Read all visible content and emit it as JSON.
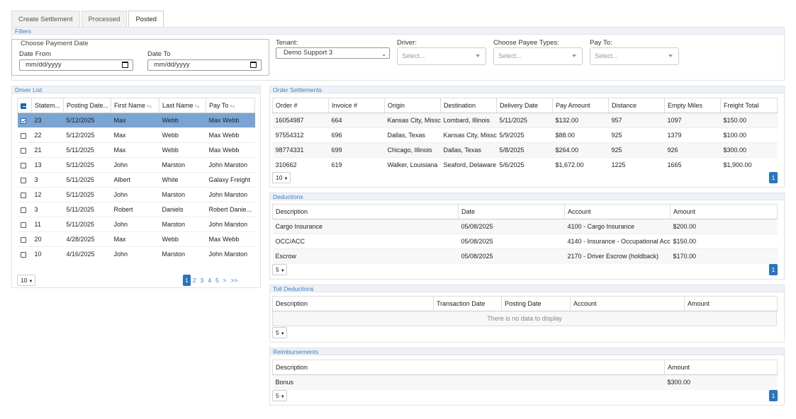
{
  "tabs": [
    "Create Settlement",
    "Processed",
    "Posted"
  ],
  "active_tab": "Posted",
  "filters": {
    "title": "Filters",
    "payment_date_group": "Choose Payment Date",
    "date_from_label": "Date From",
    "date_from_value": "mm/dd/yyyy",
    "date_to_label": "Date To",
    "date_to_value": "mm/dd/yyyy",
    "tenant_label": "Tenant:",
    "tenant_value": "Demo Support 3",
    "driver_label": "Driver:",
    "driver_placeholder": "Select...",
    "payee_types_label": "Choose Payee Types:",
    "payee_types_placeholder": "Select...",
    "pay_to_label": "Pay To:",
    "pay_to_placeholder": "Select..."
  },
  "driver_list": {
    "title": "Driver List",
    "columns": [
      "Statem...",
      "Posting Date...",
      "First Name",
      "Last Name",
      "Pay To"
    ],
    "rows": [
      {
        "checked": true,
        "statement": "23",
        "date": "5/12/2025",
        "first": "Max",
        "last": "Webb",
        "pay_to": "Max Webb"
      },
      {
        "checked": false,
        "statement": "22",
        "date": "5/12/2025",
        "first": "Max",
        "last": "Webb",
        "pay_to": "Max Webb"
      },
      {
        "checked": false,
        "statement": "21",
        "date": "5/11/2025",
        "first": "Max",
        "last": "Webb",
        "pay_to": "Max Webb"
      },
      {
        "checked": false,
        "statement": "13",
        "date": "5/11/2025",
        "first": "John",
        "last": "Marston",
        "pay_to": "John Marston"
      },
      {
        "checked": false,
        "statement": "3",
        "date": "5/11/2025",
        "first": "Albert",
        "last": "White",
        "pay_to": "Galaxy Freight"
      },
      {
        "checked": false,
        "statement": "12",
        "date": "5/11/2025",
        "first": "John",
        "last": "Marston",
        "pay_to": "John Marston"
      },
      {
        "checked": false,
        "statement": "3",
        "date": "5/11/2025",
        "first": "Robert",
        "last": "Daniels",
        "pay_to": "Robert Danie..."
      },
      {
        "checked": false,
        "statement": "11",
        "date": "5/11/2025",
        "first": "John",
        "last": "Marston",
        "pay_to": "John Marston"
      },
      {
        "checked": false,
        "statement": "20",
        "date": "4/28/2025",
        "first": "Max",
        "last": "Webb",
        "pay_to": "Max Webb"
      },
      {
        "checked": false,
        "statement": "10",
        "date": "4/16/2025",
        "first": "John",
        "last": "Marston",
        "pay_to": "John Marston"
      }
    ],
    "page_size": "10",
    "pages": [
      "1",
      "2",
      "3",
      "4",
      "5",
      ">",
      ">>"
    ],
    "current_page": "1"
  },
  "order_settlements": {
    "title": "Order Settlements",
    "columns": [
      "Order #",
      "Invoice #",
      "Origin",
      "Destination",
      "Delivery Date",
      "Pay Amount",
      "Distance",
      "Empty Miles",
      "Freight Total"
    ],
    "rows": [
      [
        "16054987",
        "664",
        "Kansas City, Missc",
        "Lombard, Illinois",
        "5/11/2025",
        "$132.00",
        "957",
        "1097",
        "$150.00"
      ],
      [
        "97554312",
        "696",
        "Dallas, Texas",
        "Kansas City, Missc",
        "5/9/2025",
        "$88.00",
        "925",
        "1379",
        "$100.00"
      ],
      [
        "98774331",
        "699",
        "Chicago, Illinois",
        "Dallas, Texas",
        "5/8/2025",
        "$264.00",
        "925",
        "926",
        "$300.00"
      ],
      [
        "310662",
        "619",
        "Walker, Louisiana",
        "Seaford, Delaware",
        "5/6/2025",
        "$1,672.00",
        "1225",
        "1665",
        "$1,900.00"
      ]
    ],
    "page_size": "10",
    "page": "1"
  },
  "deductions": {
    "title": "Deductions",
    "columns": [
      "Description",
      "Date",
      "Account",
      "Amount"
    ],
    "rows": [
      [
        "Cargo Insurance",
        "05/08/2025",
        "4100 - Cargo Insurance",
        "$200.00"
      ],
      [
        "OCC/ACC",
        "05/08/2025",
        "4140 - Insurance - Occupational Acc",
        "$150.00"
      ],
      [
        "Escrow",
        "05/08/2025",
        "2170 - Driver Escrow (holdback)",
        "$170.00"
      ]
    ],
    "page_size": "5",
    "page": "1"
  },
  "toll_deductions": {
    "title": "Toll Deductions",
    "columns": [
      "Description",
      "Transaction Date",
      "Posting Date",
      "Account",
      "Amount"
    ],
    "empty_message": "There is no data to display",
    "page_size": "5"
  },
  "reimbursements": {
    "title": "Reimbursements",
    "columns": [
      "Description",
      "Amount"
    ],
    "rows": [
      [
        "Bonus",
        "$300.00"
      ]
    ],
    "page_size": "5",
    "page": "1"
  },
  "colors": {
    "accent": "#2a74c0",
    "selected_row": "#7aa5d2",
    "header_text": "#3a7dc4"
  }
}
